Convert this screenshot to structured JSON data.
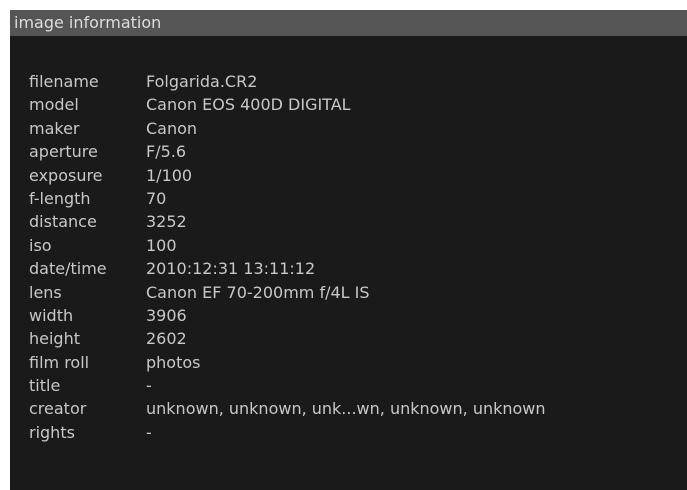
{
  "panel": {
    "title": "image information",
    "background": "#1a1a1a",
    "header_background": "#555555",
    "text_color": "#c8c8c8"
  },
  "info": [
    {
      "key": "filename",
      "value": "Folgarida.CR2"
    },
    {
      "key": "model",
      "value": "Canon EOS 400D DIGITAL"
    },
    {
      "key": "maker",
      "value": "Canon"
    },
    {
      "key": "aperture",
      "value": "F/5.6"
    },
    {
      "key": "exposure",
      "value": "1/100"
    },
    {
      "key": "f-length",
      "value": "70"
    },
    {
      "key": "distance",
      "value": "3252"
    },
    {
      "key": "iso",
      "value": "100"
    },
    {
      "key": "date/time",
      "value": "2010:12:31 13:11:12"
    },
    {
      "key": "lens",
      "value": "Canon EF 70-200mm f/4L IS"
    },
    {
      "key": "width",
      "value": "3906"
    },
    {
      "key": "height",
      "value": "2602"
    },
    {
      "key": "film roll",
      "value": "photos"
    },
    {
      "key": "title",
      "value": "-"
    },
    {
      "key": "creator",
      "value": "unknown, unknown, unk...wn, unknown, unknown"
    },
    {
      "key": "rights",
      "value": "-"
    }
  ]
}
